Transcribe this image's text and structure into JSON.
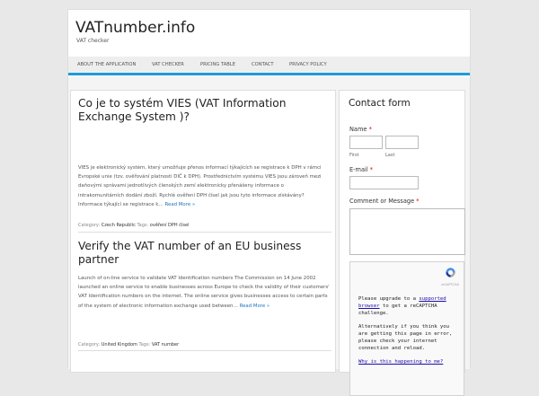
{
  "site": {
    "title": "VATnumber.info",
    "description": "VAT checker"
  },
  "nav": {
    "items": [
      {
        "label": "About the application"
      },
      {
        "label": "VAT checker"
      },
      {
        "label": "Pricing table"
      },
      {
        "label": "Contact"
      },
      {
        "label": "Privacy policy"
      }
    ]
  },
  "posts": [
    {
      "title": "Co je to systém VIES (VAT Information Exchange System )?",
      "excerpt": "VIES je elektronický systém, který umožňuje přenos informací týkajících se registrace k DPH v rámci Evropské unie (tzv. ověřování platnosti DIČ k DPH). Prostřednictvím systému VIES jsou zároveň mezi daňovými správami jednotlivých členských zemí elektronicky přenášeny informace o intrakomunitárních dodání zboží. Rychlé ověření DPH čísel jak jsou tyto informace získávány? Informace týkající se registrace k…",
      "read_more": "Read More »",
      "category_label": "Category:",
      "category": "Czech Republic",
      "tags_label": "Tags:",
      "tag": "ověření DPH čísel"
    },
    {
      "title": "Verify the VAT number of an EU business partner",
      "excerpt": "Launch of on-line service to validate VAT Identification numbers The Commission on 14 June 2002 launched an online service to enable businesses across Europe to check the validity of their customers' VAT Identification numbers on the internet.  The online service gives businesses access to certain parts of the system of electronic information exchange used between…",
      "read_more": "Read More »",
      "category_label": "Category:",
      "category": "United Kingdom",
      "tags_label": "Tags:",
      "tag": "VAT number"
    }
  ],
  "sidebar": {
    "widget_title": "Contact form",
    "name_label": "Name",
    "first_label": "First",
    "last_label": "Last",
    "email_label": "E-mail",
    "comment_label": "Comment or Message",
    "required_mark": "*",
    "captcha": {
      "logo_text": "reCAPTCHA",
      "message_pre": "Please upgrade to a ",
      "message_link": "supported browser",
      "message_post": " to get a reCAPTCHA challenge.",
      "message2": "Alternatively if you think you are getting this page in error, please check your internet connection and reload.",
      "why_link": "Why is this happening to me?"
    }
  },
  "colors": {
    "accent": "#1e9bd7",
    "link": "#1e73be",
    "required": "#dd0000"
  }
}
